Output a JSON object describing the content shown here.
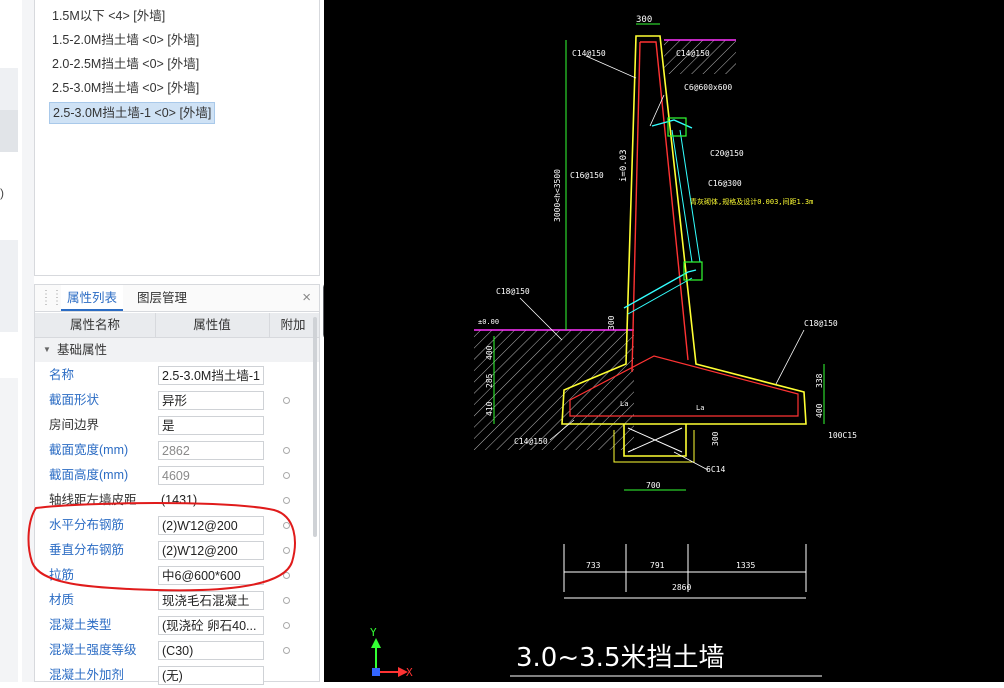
{
  "component_list": {
    "items": [
      {
        "label": "1.5M以下 <4> [外墙]"
      },
      {
        "label": "1.5-2.0M挡土墙 <0> [外墙]"
      },
      {
        "label": "2.0-2.5M挡土墙 <0> [外墙]"
      },
      {
        "label": "2.5-3.0M挡土墙 <0> [外墙]"
      },
      {
        "label": "2.5-3.0M挡土墙-1 <0> [外墙]",
        "selected": true
      }
    ]
  },
  "left_strip": {
    "paren": ")"
  },
  "panel": {
    "tabs": [
      "属性列表",
      "图层管理"
    ],
    "close": "×",
    "columns": [
      "属性名称",
      "属性值",
      "附加"
    ],
    "group": "基础属性",
    "rows": [
      {
        "name": "名称",
        "value": "2.5-3.0M挡土墙-1"
      },
      {
        "name": "截面形状",
        "value": "异形"
      },
      {
        "name": "房间边界",
        "value": "是"
      },
      {
        "name": "截面宽度(mm)",
        "value": "2862"
      },
      {
        "name": "截面高度(mm)",
        "value": "4609"
      },
      {
        "name": "轴线距左墙皮距...",
        "value": "(1431)"
      },
      {
        "name": "水平分布钢筋",
        "value": "(2)Ⱳ12@200"
      },
      {
        "name": "垂直分布钢筋",
        "value": "(2)Ⱳ12@200"
      },
      {
        "name": "拉筋",
        "value": "中6@600*600"
      },
      {
        "name": "材质",
        "value": "现浇毛石混凝土"
      },
      {
        "name": "混凝土类型",
        "value": "(现浇砼 卵石40..."
      },
      {
        "name": "混凝土强度等级",
        "value": "(C30)"
      },
      {
        "name": "混凝土外加剂",
        "value": "(无)"
      }
    ]
  },
  "cad": {
    "title": "3.0~3.5米挡土墙",
    "axis_x": "X",
    "axis_y": "Y",
    "labels": {
      "top_dim": "300",
      "rebar_top_left": "C14@150",
      "rebar_top_right": "C14@150",
      "tie": "C6@600x600",
      "rebar_c20": "C20@150",
      "rebar_c16_left": "C16@150",
      "rebar_c16_right": "C16@300",
      "note": "青灰砌体,规格及设计0.003,间距1.3m",
      "height_dim": "3000<h<3500",
      "rebar_c18_left": "C18@150",
      "rebar_c18_right": "C18@150",
      "elev": "±0.00",
      "dim_300_mid": "300",
      "dim_400_a": "400",
      "dim_285": "285",
      "dim_410": "410",
      "dim_338": "338",
      "dim_400_b": "400",
      "la_left": "La",
      "la_right": "La",
      "rebar_bottom": "C14@150",
      "dim_300_key": "300",
      "c15": "100C15",
      "c14": "6C14",
      "key_width": "700",
      "slope_text": "i=0.03",
      "seg_1": "733",
      "seg_2": "791",
      "seg_3": "1335",
      "total": "2860"
    }
  }
}
